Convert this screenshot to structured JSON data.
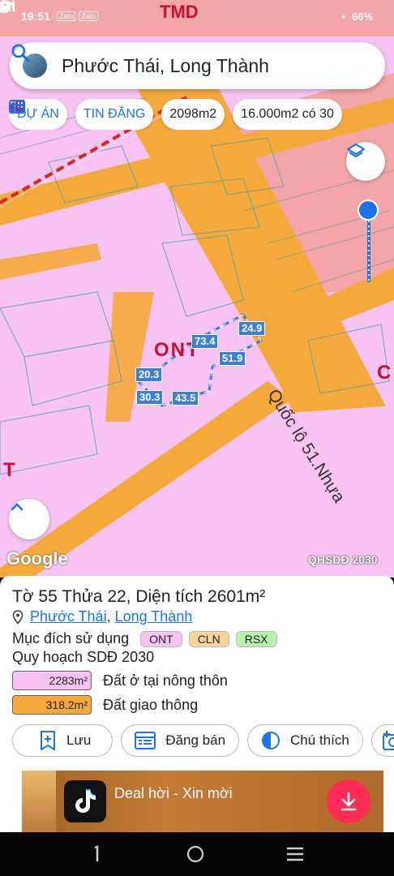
{
  "status_bar": {
    "time": "19:51",
    "mini_icons": [
      "Zalo",
      "Zalo"
    ],
    "battery": "66%"
  },
  "map": {
    "top_label": "TMD",
    "road_name": "Quốc lộ 51.Nhựa",
    "zone_label": "ONT",
    "edge_labels": [
      "C",
      "C",
      "T"
    ],
    "measurements": [
      "24.9",
      "73.4",
      "51.9",
      "20.3",
      "30.3",
      "43.5"
    ],
    "google_logo": "Google",
    "layer_label": "QHSDĐ 2030",
    "colors": {
      "residential": "#f7c3f2",
      "road": "#f6a93b",
      "commercial": "#f4a5a8",
      "parcel": "#3b7fd6"
    }
  },
  "search": {
    "query": "Phước Thái, Long Thành",
    "icon": "search-icon"
  },
  "chips": [
    {
      "label": "DỰ ÁN",
      "icon": "building-icon"
    },
    {
      "label": "TIN ĐĂNG",
      "icon": "calendar-icon"
    },
    {
      "label": "2098m2"
    },
    {
      "label": "16.000m2 có 30"
    }
  ],
  "panel": {
    "title": "Tờ 55 Thửa 22, Diện tích 2601m²",
    "location": {
      "commune": "Phước Thái",
      "separator": ",",
      "district": "Long Thành"
    },
    "purpose_label": "Mục đích sử dụng",
    "purpose_tags": [
      {
        "code": "ONT",
        "color": "#f7c3f2"
      },
      {
        "code": "CLN",
        "color": "#f8d39a"
      },
      {
        "code": "RSX",
        "color": "#b9f0b0"
      }
    ],
    "plan_label": "Quy hoạch SDĐ 2030",
    "legend": [
      {
        "area": "2283m²",
        "desc": "Đất ở tại nông thôn",
        "color": "#f7c3f2"
      },
      {
        "area": "318.2m²",
        "desc": "Đất giao thông",
        "color": "#f6a93b"
      }
    ],
    "actions": [
      {
        "label": "Lưu",
        "icon": "bookmark-add-icon"
      },
      {
        "label": "Đăng bán",
        "icon": "list-icon"
      },
      {
        "label": "Chú thích",
        "icon": "contrast-icon"
      },
      {
        "label": "",
        "icon": "add-photo-icon"
      }
    ]
  },
  "ad": {
    "text": "Deal hời - Xin mời"
  }
}
